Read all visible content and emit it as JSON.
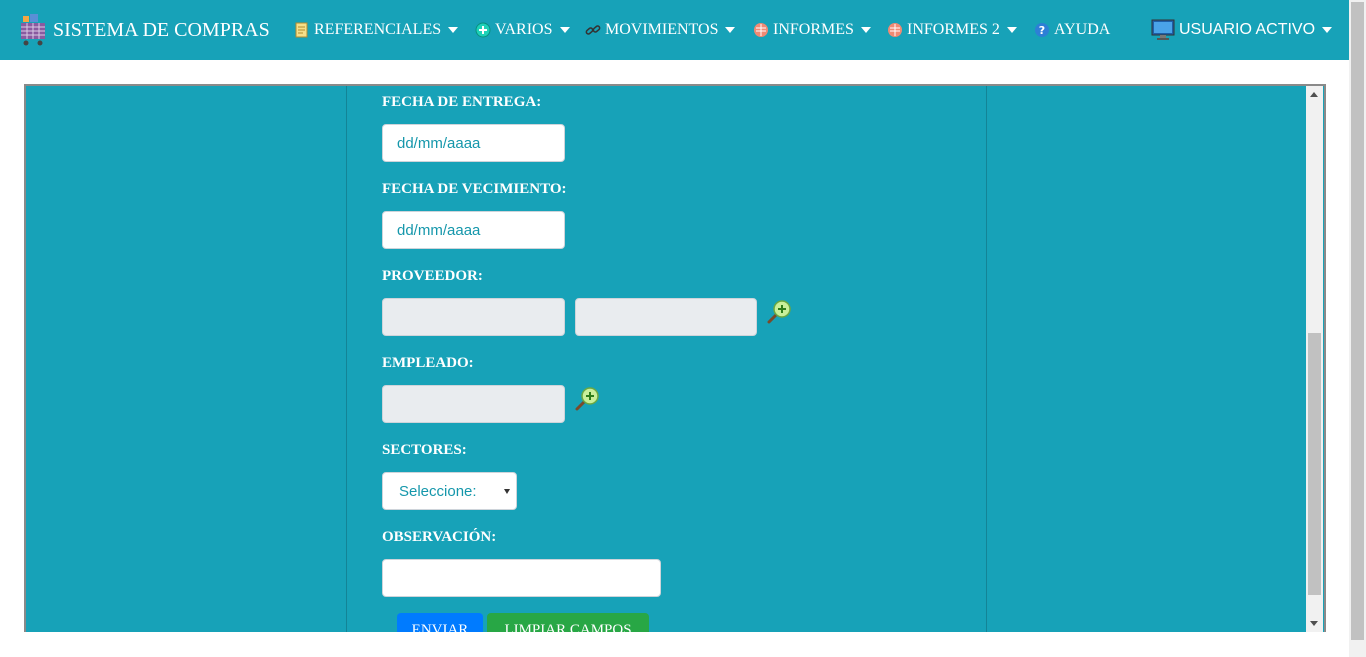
{
  "navbar": {
    "brand": "SISTEMA DE COMPRAS",
    "items": [
      {
        "label": "REFERENCIALES",
        "icon": "document-icon",
        "dropdown": true
      },
      {
        "label": "VARIOS",
        "icon": "plus-circle-icon",
        "dropdown": true
      },
      {
        "label": "MOVIMIENTOS",
        "icon": "link-icon",
        "dropdown": true
      },
      {
        "label": "INFORMES",
        "icon": "report-icon",
        "dropdown": true
      },
      {
        "label": "INFORMES 2",
        "icon": "report-icon",
        "dropdown": true
      },
      {
        "label": "AYUDA",
        "icon": "help-icon",
        "dropdown": false
      }
    ],
    "user": {
      "label": "USUARIO ACTIVO",
      "icon": "monitor-icon"
    }
  },
  "form": {
    "fecha_entrega": {
      "label": "FECHA DE ENTREGA:",
      "placeholder": "dd/mm/aaaa"
    },
    "fecha_vencimiento": {
      "label": "FECHA DE VECIMIENTO:",
      "placeholder": "dd/mm/aaaa"
    },
    "proveedor": {
      "label": "PROVEEDOR:",
      "value_1": "",
      "value_2": ""
    },
    "empleado": {
      "label": "EMPLEADO:",
      "value": ""
    },
    "sectores": {
      "label": "SECTORES:",
      "selected": "Seleccione:"
    },
    "observacion": {
      "label": "OBSERVACIÓN:",
      "value": ""
    },
    "buttons": {
      "enviar": "ENVIAR",
      "limpiar": "LIMPIAR CAMPOS"
    }
  },
  "colors": {
    "primary": "#17a2b8",
    "button_primary": "#007bff",
    "button_success": "#28a745"
  }
}
